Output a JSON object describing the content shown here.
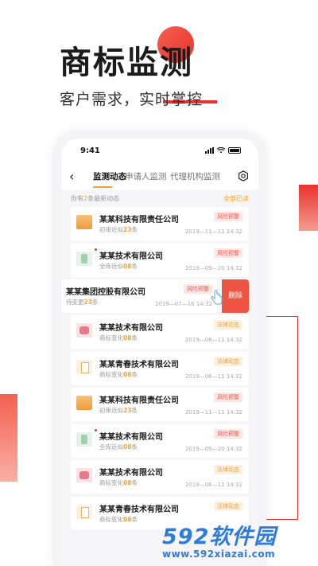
{
  "promo": {
    "title": "商标监测",
    "subtitle": "客户需求，实时掌控"
  },
  "status_bar": {
    "time": "9:41",
    "icons": [
      "signal-icon",
      "wifi-icon",
      "battery-icon"
    ]
  },
  "nav": {
    "back_icon": "chevron-left-icon",
    "tabs": [
      {
        "label": "监测动态",
        "active": true
      },
      {
        "label": "申请人监测",
        "active": false
      },
      {
        "label": "代理机构监测",
        "active": false
      }
    ],
    "settings_icon": "gear-icon"
  },
  "notice": {
    "prefix": "你有",
    "count": "2",
    "suffix": "条最新动态",
    "read_all": "全部已读"
  },
  "cards": [
    {
      "company": "某某科技有限责任公司",
      "detail_prefix": "初审近似",
      "num": "23",
      "detail_suffix": "条",
      "badge": "风险预警",
      "badge_type": "risk",
      "date": "2019—11—11 14:32",
      "logo": "orange"
    },
    {
      "company": "某某技术有限公司",
      "detail_prefix": "全库近似",
      "num": "08",
      "detail_suffix": "条",
      "badge": "风险预警",
      "badge_type": "risk",
      "date": "2019—09—20 14:32",
      "logo": "green"
    },
    {
      "company": "某某集团控股有限公司",
      "detail_prefix": "待变更",
      "num": "23",
      "detail_suffix": "条",
      "badge": "风险预警",
      "badge_type": "risk",
      "date": "2019—07—16 14:32",
      "logo": "none"
    },
    {
      "company": "某某技术有限公司",
      "detail_prefix": "商标变化",
      "num": "08",
      "detail_suffix": "条",
      "badge": "法律动态",
      "badge_type": "legal",
      "date": "2019—06—11 14:32",
      "logo": "pink"
    },
    {
      "company": "某某青春技术有限公司",
      "detail_prefix": "商标变化",
      "num": "08",
      "detail_suffix": "条",
      "badge": "法律动态",
      "badge_type": "legal",
      "date": "2019—06—11 14:32",
      "logo": "doc"
    },
    {
      "company": "某某科技有限责任公司",
      "detail_prefix": "初审近似",
      "num": "23",
      "detail_suffix": "条",
      "badge": "风险预警",
      "badge_type": "risk",
      "date": "2019—11—11 14:32",
      "logo": "orange"
    },
    {
      "company": "某某技术有限公司",
      "detail_prefix": "全库近似",
      "num": "08",
      "detail_suffix": "条",
      "badge": "风险预警",
      "badge_type": "risk",
      "date": "2019—09—20 14:32",
      "logo": "green"
    },
    {
      "company": "某某技术有限公司",
      "detail_prefix": "商标变化",
      "num": "08",
      "detail_suffix": "条",
      "badge": "法律动态",
      "badge_type": "legal",
      "date": "2019—06—11 14:32",
      "logo": "pink"
    },
    {
      "company": "某某青春技术有限公司",
      "detail_prefix": "商标变化",
      "num": "08",
      "detail_suffix": "条",
      "badge": "法律动态",
      "badge_type": "legal",
      "date": "",
      "logo": "doc"
    }
  ],
  "swipe_action": {
    "delete_label": "删除"
  },
  "watermark": {
    "brand_num": "592",
    "brand_text": "软件园",
    "url": "www.592xiazai.com"
  },
  "colors": {
    "accent_red": "#e9322d",
    "accent_orange": "#f2a23a",
    "watermark_blue": "#2e7cd8"
  }
}
